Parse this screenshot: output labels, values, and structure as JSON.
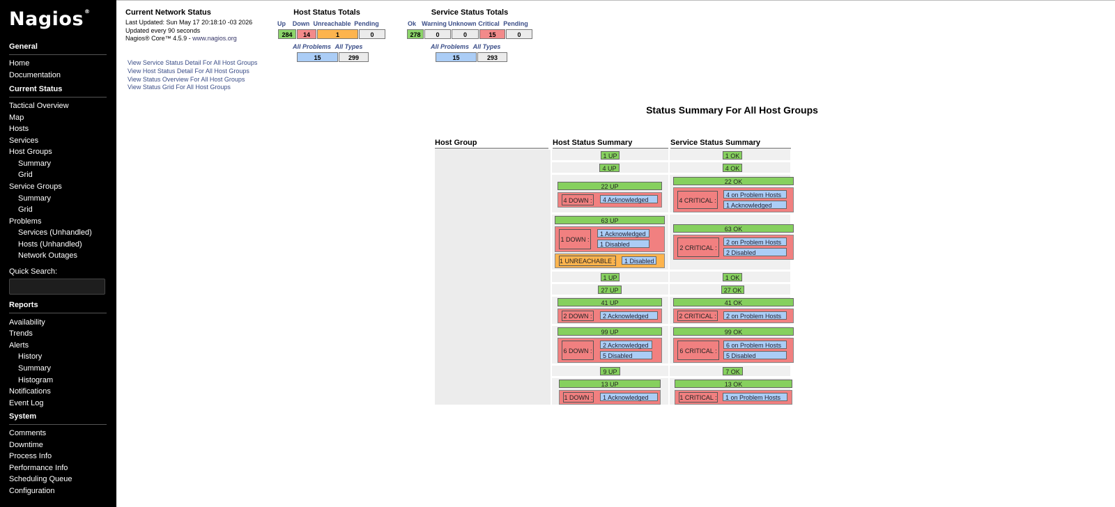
{
  "sidebar": {
    "logo": "Nagios",
    "logo_mark": "®",
    "sections": {
      "general": "General",
      "current_status": "Current Status",
      "reports": "Reports",
      "system": "System"
    },
    "items": {
      "home": "Home",
      "documentation": "Documentation",
      "tactical_overview": "Tactical Overview",
      "map": "Map",
      "hosts": "Hosts",
      "services": "Services",
      "host_groups": "Host Groups",
      "host_groups_summary": "Summary",
      "host_groups_grid": "Grid",
      "service_groups": "Service Groups",
      "service_groups_summary": "Summary",
      "service_groups_grid": "Grid",
      "problems": "Problems",
      "services_unhandled": "Services (Unhandled)",
      "hosts_unhandled": "Hosts (Unhandled)",
      "network_outages": "Network Outages",
      "quick_search_label": "Quick Search:",
      "availability": "Availability",
      "trends": "Trends",
      "alerts": "Alerts",
      "alerts_history": "History",
      "alerts_summary": "Summary",
      "alerts_histogram": "Histogram",
      "notifications": "Notifications",
      "event_log": "Event Log",
      "comments": "Comments",
      "downtime": "Downtime",
      "process_info": "Process Info",
      "performance_info": "Performance Info",
      "scheduling_queue": "Scheduling Queue",
      "configuration": "Configuration"
    }
  },
  "info": {
    "title": "Current Network Status",
    "last_updated": "Last Updated: Sun May 17 20:18:10 -03 2026",
    "update_interval": "Updated every 90 seconds",
    "version": "Nagios® Core™ 4.5.9 - ",
    "site_link": "www.nagios.org"
  },
  "links": {
    "service_detail": "View Service Status Detail For All Host Groups",
    "host_detail": "View Host Status Detail For All Host Groups",
    "status_overview": "View Status Overview For All Host Groups",
    "status_grid": "View Status Grid For All Host Groups"
  },
  "host_totals": {
    "title": "Host Status Totals",
    "headers": {
      "up": "Up",
      "down": "Down",
      "unreachable": "Unreachable",
      "pending": "Pending"
    },
    "values": {
      "up": "284",
      "down": "14",
      "unreachable": "1",
      "pending": "0"
    },
    "sub_headers": {
      "problems": "All Problems",
      "types": "All Types"
    },
    "sub_values": {
      "problems": "15",
      "types": "299"
    }
  },
  "service_totals": {
    "title": "Service Status Totals",
    "headers": {
      "ok": "Ok",
      "warning": "Warning",
      "unknown": "Unknown",
      "critical": "Critical",
      "pending": "Pending"
    },
    "values": {
      "ok": "278",
      "warning": "0",
      "unknown": "0",
      "critical": "15",
      "pending": "0"
    },
    "sub_headers": {
      "problems": "All Problems",
      "types": "All Types"
    },
    "sub_values": {
      "problems": "15",
      "types": "293"
    }
  },
  "summary": {
    "title": "Status Summary For All Host Groups",
    "col_host_group": "Host Group",
    "col_host_status": "Host Status Summary",
    "col_service_status": "Service Status Summary",
    "rows": [
      {
        "host_up": "1 UP",
        "svc_ok": "1 OK"
      },
      {
        "host_up": "4 UP",
        "svc_ok": "4 OK"
      },
      {
        "host_up": "22 UP",
        "host_down": "4 DOWN :",
        "host_down_ack": "4 Acknowledged",
        "svc_ok": "22 OK",
        "svc_crit": "4 CRITICAL :",
        "svc_crit_problem": "4 on Problem Hosts",
        "svc_crit_ack": "1 Acknowledged"
      },
      {
        "host_up": "63 UP",
        "host_down": "1 DOWN :",
        "host_down_ack": "1 Acknowledged",
        "host_down_dis": "1 Disabled",
        "host_unreach": "1 UNREACHABLE :",
        "host_unreach_dis": "1 Disabled",
        "svc_ok": "63 OK",
        "svc_crit": "2 CRITICAL :",
        "svc_crit_problem": "2 on Problem Hosts",
        "svc_crit_dis": "2 Disabled"
      },
      {
        "host_up": "1 UP",
        "svc_ok": "1 OK"
      },
      {
        "host_up": "27 UP",
        "svc_ok": "27 OK"
      },
      {
        "host_up": "41 UP",
        "host_down": "2 DOWN :",
        "host_down_ack": "2 Acknowledged",
        "svc_ok": "41 OK",
        "svc_crit": "2 CRITICAL :",
        "svc_crit_problem": "2 on Problem Hosts"
      },
      {
        "host_up": "99 UP",
        "host_down": "6 DOWN :",
        "host_down_ack": "2 Acknowledged",
        "host_down_dis": "5 Disabled",
        "svc_ok": "99 OK",
        "svc_crit": "6 CRITICAL :",
        "svc_crit_problem": "6 on Problem Hosts",
        "svc_crit_dis": "5 Disabled"
      },
      {
        "host_up": "9 UP",
        "svc_ok": "7 OK"
      },
      {
        "host_up": "13 UP",
        "host_down": "1 DOWN :",
        "host_down_ack": "1 Acknowledged",
        "svc_ok": "13 OK",
        "svc_crit": "1 CRITICAL :",
        "svc_crit_problem": "1 on Problem Hosts"
      }
    ]
  },
  "colors": {
    "up_ok": "#86d05e",
    "down_critical": "#f18080",
    "unreachable": "#fdb44e",
    "info_blue": "#abcdf6",
    "sidebar_bg": "#000000"
  }
}
